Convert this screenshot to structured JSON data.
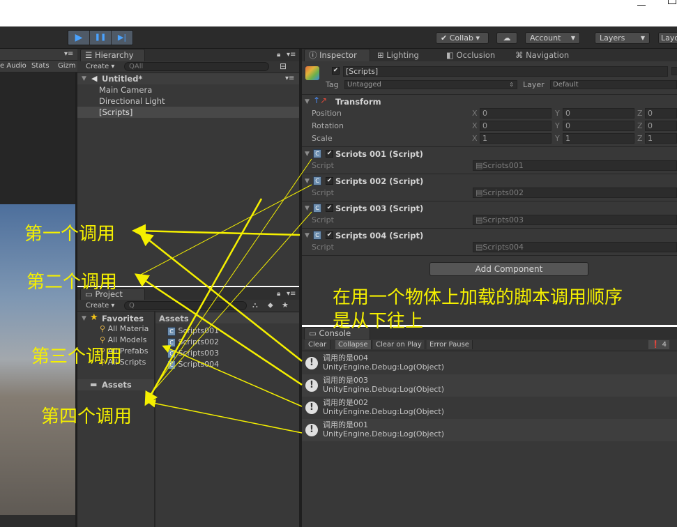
{
  "toolbar": {
    "play": "▶",
    "pause": "❚❚",
    "step": "▶|",
    "collab": "Collab ▾",
    "cloud": "☁",
    "account": "Account",
    "layers": "Layers",
    "layout": "Layo"
  },
  "scene": {
    "labels": [
      "e Audio",
      "Stats",
      "Gizm"
    ]
  },
  "hierarchy": {
    "tab": "Hierarchy",
    "create": "Create ▾",
    "search_placeholder": "All",
    "scene_name": "Untitled*",
    "items": [
      "Main Camera",
      "Directional Light",
      "[Scripts]"
    ]
  },
  "project": {
    "tab": "Project",
    "create": "Create ▾",
    "favorites_label": "Favorites",
    "favorites": [
      "All Materia",
      "All Models",
      "All Prefabs",
      "All Scripts"
    ],
    "assets_root": "Assets",
    "assets_header": "Assets",
    "assets": [
      "Scripts001",
      "Scripts002",
      "Scripts003",
      "Scripts004"
    ]
  },
  "inspector": {
    "tabs": [
      "Inspector",
      "Lighting",
      "Occlusion",
      "Navigation"
    ],
    "object_name": "[Scripts]",
    "tag_label": "Tag",
    "tag_value": "Untagged",
    "layer_label": "Layer",
    "layer_value": "Default",
    "transform": {
      "title": "Transform",
      "rows": [
        {
          "label": "Position",
          "x": "0",
          "y": "0",
          "z": "0"
        },
        {
          "label": "Rotation",
          "x": "0",
          "y": "0",
          "z": "0"
        },
        {
          "label": "Scale",
          "x": "1",
          "y": "1",
          "z": "1"
        }
      ]
    },
    "components": [
      {
        "title": "Scriots 001 (Script)",
        "field_label": "Script",
        "value": "Scriots001"
      },
      {
        "title": "Scripts 002 (Script)",
        "field_label": "Script",
        "value": "Scripts002"
      },
      {
        "title": "Scripts 003 (Script)",
        "field_label": "Script",
        "value": "Scripts003"
      },
      {
        "title": "Scripts 004 (Script)",
        "field_label": "Script",
        "value": "Scripts004"
      }
    ],
    "add_component": "Add Component"
  },
  "console": {
    "tab": "Console",
    "buttons": [
      "Clear",
      "Collapse",
      "Clear on Play",
      "Error Pause"
    ],
    "count": "4",
    "entries": [
      {
        "line1": "调用的是004",
        "line2": "UnityEngine.Debug:Log(Object)"
      },
      {
        "line1": "调用的是003",
        "line2": "UnityEngine.Debug:Log(Object)"
      },
      {
        "line1": "调用的是002",
        "line2": "UnityEngine.Debug:Log(Object)"
      },
      {
        "line1": "调用的是001",
        "line2": "UnityEngine.Debug:Log(Object)"
      }
    ]
  },
  "annotations": {
    "labels": [
      "第一个调用",
      "第二个调用",
      "第三个调用",
      "第四个调用"
    ],
    "note_line1": "在用一个物体上加载的脚本调用顺序",
    "note_line2": "是从下往上"
  },
  "colors": {
    "annotation": "#f5f000",
    "panel": "#383838",
    "accent_play": "#4aa3ff"
  }
}
